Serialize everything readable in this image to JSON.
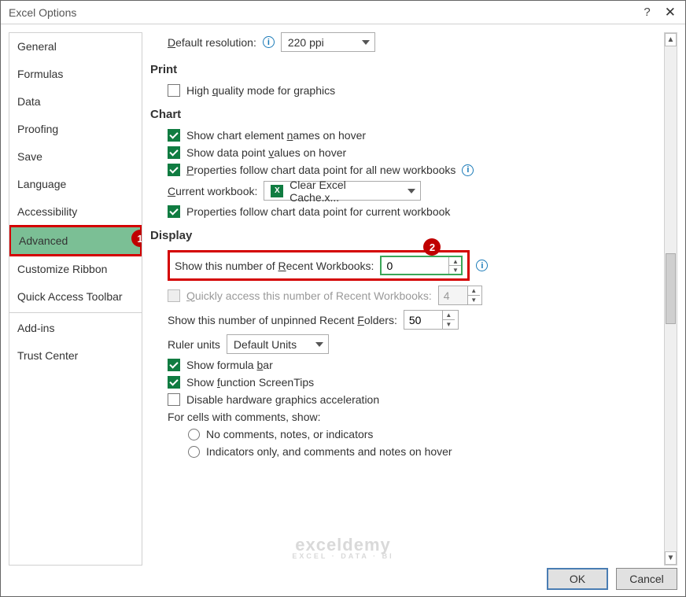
{
  "window": {
    "title": "Excel Options"
  },
  "sidebar": {
    "items": [
      {
        "label": "General"
      },
      {
        "label": "Formulas"
      },
      {
        "label": "Data"
      },
      {
        "label": "Proofing"
      },
      {
        "label": "Save"
      },
      {
        "label": "Language"
      },
      {
        "label": "Accessibility"
      },
      {
        "label": "Advanced"
      },
      {
        "label": "Customize Ribbon"
      },
      {
        "label": "Quick Access Toolbar"
      },
      {
        "label": "Add-ins"
      },
      {
        "label": "Trust Center"
      }
    ]
  },
  "annotations": {
    "badge1": "1",
    "badge2": "2"
  },
  "content": {
    "default_res_label_pre": "D",
    "default_res_label_post": "efault resolution:",
    "default_res_value": "220 ppi",
    "print_head": "Print",
    "hq_pre": "High ",
    "hq_u": "q",
    "hq_post": "uality mode for graphics",
    "chart_head": "Chart",
    "chart1_pre": "Show chart element ",
    "chart1_u": "n",
    "chart1_post": "ames on hover",
    "chart2_pre": "Show data point ",
    "chart2_u": "v",
    "chart2_post": "alues on hover",
    "chart3_u": "P",
    "chart3_post": "roperties follow chart data point for all new workbooks",
    "cw_u": "C",
    "cw_post": "urrent workbook:",
    "cw_value": "Clear Excel Cache.x...",
    "chart4": "Properties follow chart data point for current workbook",
    "display_head": "Display",
    "rw_pre": "Show this number of ",
    "rw_u": "R",
    "rw_post": "ecent Workbooks:",
    "rw_value": "0",
    "qa_u": "Q",
    "qa_post": "uickly access this number of Recent Workbooks:",
    "qa_value": "4",
    "rf_pre": "Show this number of unpinned Recent ",
    "rf_u": "F",
    "rf_post": "olders:",
    "rf_value": "50",
    "ruler_label": "Ruler units",
    "ruler_value": "Default Units",
    "fb_pre": "Show formula ",
    "fb_u": "b",
    "fb_post": "ar",
    "st_pre": "Show ",
    "st_u": "f",
    "st_post": "unction ScreenTips",
    "hw": "Disable hardware graphics acceleration",
    "comments_label": "For cells with comments, show:",
    "c1": "No comments, notes, or indicators",
    "c2": "Indicators only, and comments and notes on hover"
  },
  "footer": {
    "ok": "OK",
    "cancel": "Cancel"
  },
  "watermark": {
    "main": "exceldemy",
    "sub": "EXCEL · DATA · BI"
  }
}
